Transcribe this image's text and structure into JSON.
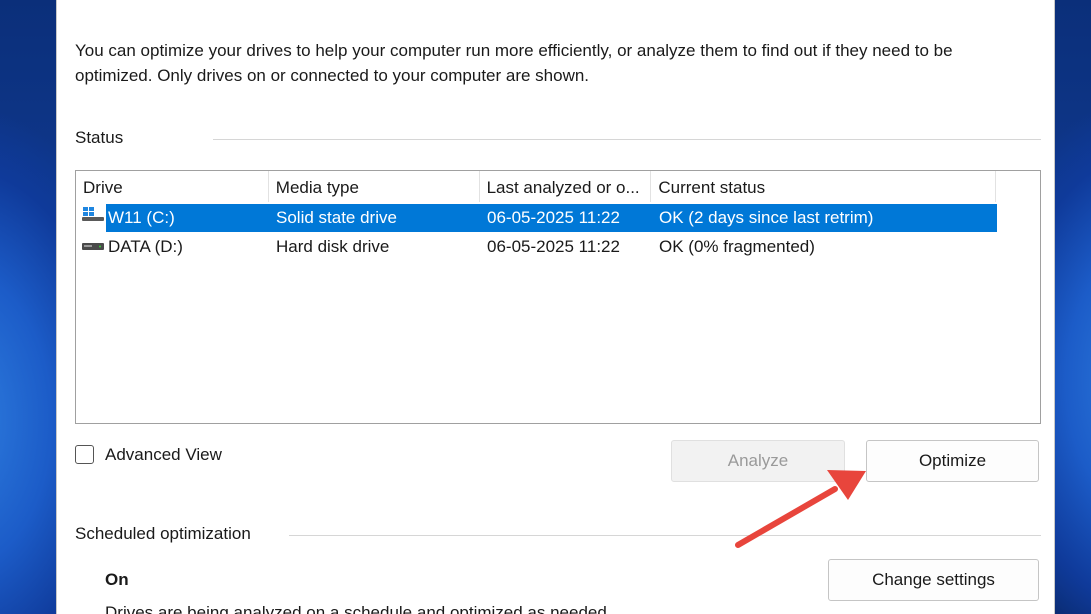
{
  "intro_text": "You can optimize your drives to help your computer run more efficiently, or analyze them to find out if they need to be optimized. Only drives on or connected to your computer are shown.",
  "status_section": {
    "title": "Status"
  },
  "drive_table": {
    "columns": [
      "Drive",
      "Media type",
      "Last analyzed or o...",
      "Current status"
    ],
    "rows": [
      {
        "drive": "W11 (C:)",
        "media_type": "Solid state drive",
        "last_analyzed": "06-05-2025 11:22",
        "status": "OK (2 days since last retrim)",
        "icon": "windows-drive-icon"
      },
      {
        "drive": "DATA (D:)",
        "media_type": "Hard disk drive",
        "last_analyzed": "06-05-2025 11:22",
        "status": "OK (0% fragmented)",
        "icon": "hard-drive-icon"
      }
    ]
  },
  "advanced_view": {
    "label": "Advanced View",
    "checked": false
  },
  "buttons": {
    "analyze": "Analyze",
    "optimize": "Optimize",
    "change_settings": "Change settings"
  },
  "scheduled_section": {
    "title": "Scheduled optimization",
    "state": "On",
    "truncated_text": "Drives are being analyzed on a schedule and optimized as needed."
  },
  "colors": {
    "selection": "#0078d7",
    "annotation_arrow": "#e8453c"
  }
}
